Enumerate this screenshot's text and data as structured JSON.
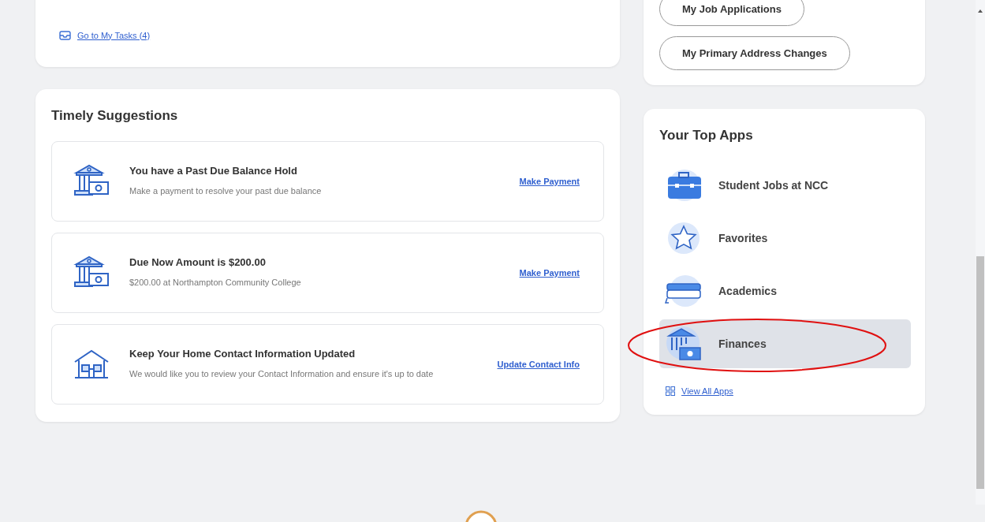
{
  "tasks_card": {
    "link": "Go to My Tasks (4)"
  },
  "timely_suggestions": {
    "title": "Timely Suggestions",
    "items": [
      {
        "kind": "finance",
        "title": "You have a Past Due Balance Hold",
        "description": "Make a payment to resolve your past due balance",
        "action": "Make Payment"
      },
      {
        "kind": "finance",
        "title": "Due Now Amount is $200.00",
        "description": "$200.00 at Northampton Community College",
        "action": "Make Payment"
      },
      {
        "kind": "home",
        "title": "Keep Your Home Contact Information Updated",
        "description": "We would like you to review your Contact Information and ensure it's up to date",
        "action": "Update Contact Info"
      }
    ]
  },
  "quick_buttons": [
    "My Job Applications",
    "My Primary Address Changes"
  ],
  "top_apps": {
    "title": "Your Top Apps",
    "items": [
      {
        "kind": "jobs",
        "label": "Student Jobs at NCC",
        "selected": false
      },
      {
        "kind": "favorites",
        "label": "Favorites",
        "selected": false
      },
      {
        "kind": "academics",
        "label": "Academics",
        "selected": false
      },
      {
        "kind": "finance",
        "label": "Finances",
        "selected": true
      }
    ],
    "link": "View All Apps"
  }
}
